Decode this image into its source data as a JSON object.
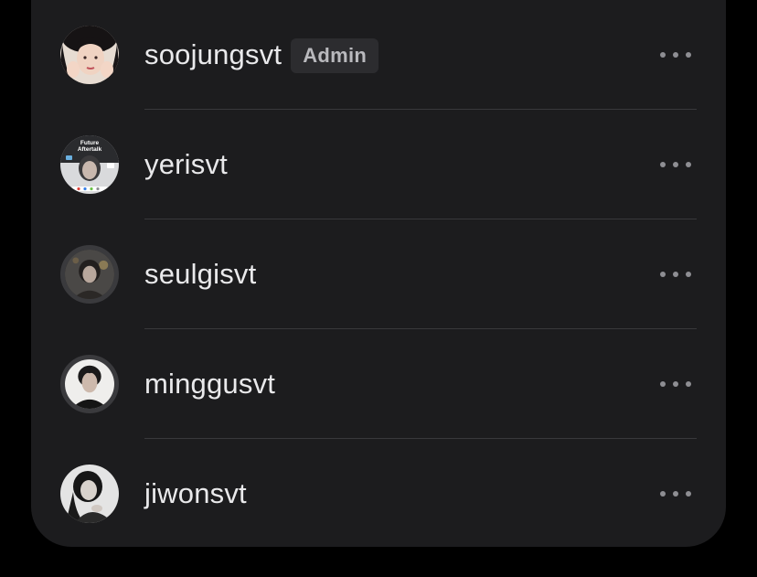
{
  "members": [
    {
      "username": "soojungsvt",
      "badge": "Admin",
      "avatar_icon": "profile-photo-icon"
    },
    {
      "username": "yerisvt",
      "avatar_icon": "profile-photo-icon",
      "avatar_text_line1": "Future",
      "avatar_text_line2": "Aftertalk"
    },
    {
      "username": "seulgisvt",
      "avatar_icon": "profile-photo-icon"
    },
    {
      "username": "minggusvt",
      "avatar_icon": "profile-photo-icon"
    },
    {
      "username": "jiwonsvt",
      "avatar_icon": "profile-photo-icon"
    }
  ],
  "colors": {
    "background": "#000000",
    "panel": "#1c1c1e",
    "text": "#e9e9eb",
    "badge_bg": "#2c2c2f",
    "badge_text": "#b9b9bd",
    "more_dots": "#8e8e93",
    "divider": "#38383b"
  },
  "icons": {
    "more": "more-horizontal-icon"
  }
}
